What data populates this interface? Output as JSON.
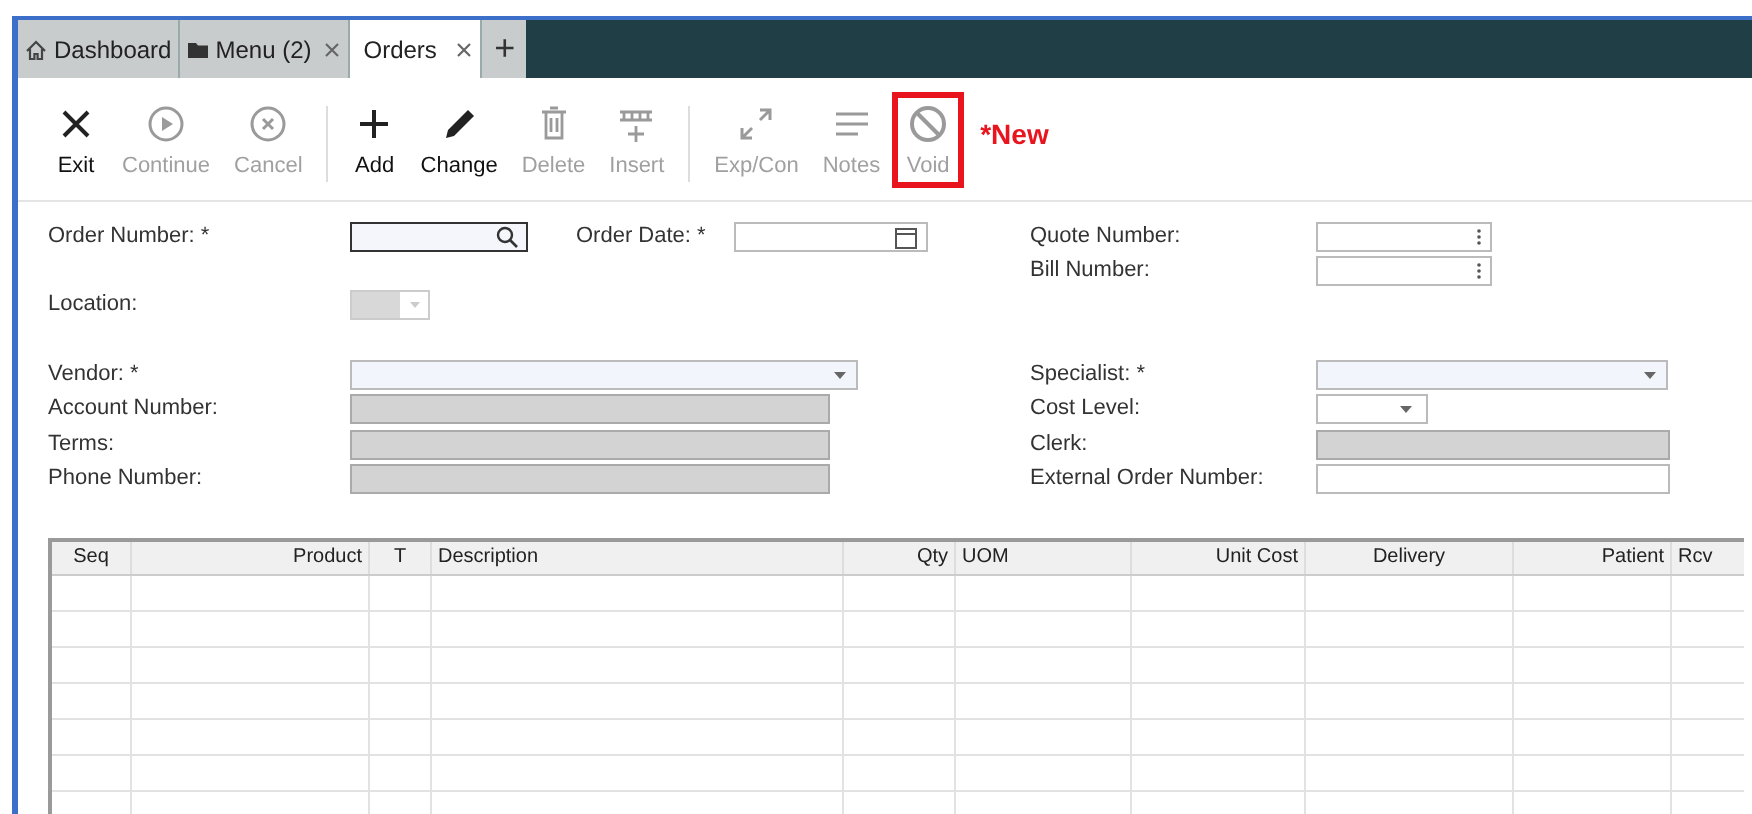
{
  "tabs": [
    {
      "label": "Dashboard",
      "kind": "home",
      "closable": false,
      "selected": false
    },
    {
      "label": "Menu (2)",
      "kind": "folder",
      "closable": true,
      "selected": false
    },
    {
      "label": "Orders",
      "kind": "plain",
      "closable": true,
      "selected": true
    }
  ],
  "new_tab": "+",
  "toolbar": [
    {
      "label": "Exit",
      "kind": "x",
      "disabled": false,
      "highlighted": false,
      "group_end": false
    },
    {
      "label": "Continue",
      "kind": "play",
      "disabled": true,
      "highlighted": false,
      "group_end": false
    },
    {
      "label": "Cancel",
      "kind": "cancel",
      "disabled": true,
      "highlighted": false,
      "group_end": true
    },
    {
      "label": "Add",
      "kind": "plus",
      "disabled": false,
      "highlighted": false,
      "group_end": false
    },
    {
      "label": "Change",
      "kind": "pencil",
      "disabled": false,
      "highlighted": false,
      "group_end": false
    },
    {
      "label": "Delete",
      "kind": "trash",
      "disabled": true,
      "highlighted": false,
      "group_end": false
    },
    {
      "label": "Insert",
      "kind": "insert",
      "disabled": true,
      "highlighted": false,
      "group_end": true
    },
    {
      "label": "Exp/Con",
      "kind": "expand",
      "disabled": true,
      "highlighted": false,
      "group_end": false
    },
    {
      "label": "Notes",
      "kind": "lines",
      "disabled": true,
      "highlighted": false,
      "group_end": false
    },
    {
      "label": "Void",
      "kind": "void",
      "disabled": true,
      "highlighted": true,
      "group_end": false
    }
  ],
  "annotation": "*New",
  "form": {
    "left": [
      {
        "label": "Order Number: *",
        "kind": "search"
      },
      {
        "label": "Location:",
        "kind": "readonly_select"
      },
      {
        "label": "Vendor: *",
        "kind": "select"
      },
      {
        "label": "Account Number:",
        "kind": "readonly"
      },
      {
        "label": "Terms:",
        "kind": "readonly"
      },
      {
        "label": "Phone Number:",
        "kind": "readonly"
      }
    ],
    "order_date": {
      "label": "Order Date: *",
      "kind": "date"
    },
    "right": [
      {
        "label": "Quote Number:",
        "kind": "menu"
      },
      {
        "label": "Bill Number:",
        "kind": "menu"
      },
      {
        "label": "Specialist: *",
        "kind": "select"
      },
      {
        "label": "Cost Level:",
        "kind": "short_select"
      },
      {
        "label": "Clerk:",
        "kind": "readonly"
      },
      {
        "label": "External Order Number:",
        "kind": "text"
      }
    ]
  },
  "table": {
    "columns": [
      {
        "label": "Seq"
      },
      {
        "label": "Product"
      },
      {
        "label": "T"
      },
      {
        "label": "Description"
      },
      {
        "label": "Qty"
      },
      {
        "label": "UOM"
      },
      {
        "label": "Unit Cost"
      },
      {
        "label": "Delivery"
      },
      {
        "label": "Patient"
      },
      {
        "label": "Rcv"
      }
    ]
  }
}
